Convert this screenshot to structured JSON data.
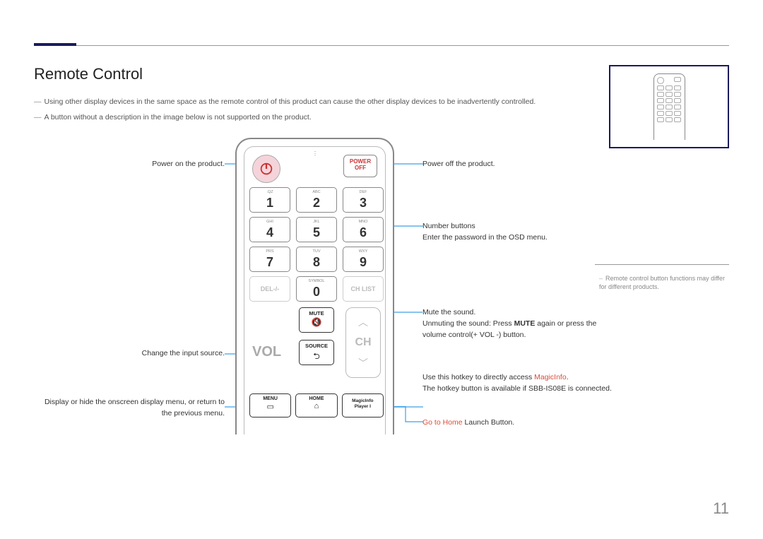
{
  "title": "Remote Control",
  "notes": {
    "n1": "Using other display devices in the same space as the remote control of this product can cause the other display devices to be inadvertently controlled.",
    "n2": "A button without a description in the image below is not supported on the product."
  },
  "buttons": {
    "power_off_line1": "POWER",
    "power_off_line2": "OFF",
    "keys": [
      {
        "sub": ".QZ",
        "d": "1"
      },
      {
        "sub": "ABC",
        "d": "2"
      },
      {
        "sub": "DEF",
        "d": "3"
      },
      {
        "sub": "GHI",
        "d": "4"
      },
      {
        "sub": "JKL",
        "d": "5"
      },
      {
        "sub": "MNO",
        "d": "6"
      },
      {
        "sub": "PRS",
        "d": "7"
      },
      {
        "sub": "TUV",
        "d": "8"
      },
      {
        "sub": "WXY",
        "d": "9"
      }
    ],
    "del": "DEL-/-",
    "symbol_sub": "SYMBOL",
    "zero": "0",
    "chlist": "CH LIST",
    "mute": "MUTE",
    "source": "SOURCE",
    "vol": "VOL",
    "ch": "CH",
    "menu": "MENU",
    "home": "HOME",
    "magicinfo_l1": "MagicInfo",
    "magicinfo_l2": "Player I"
  },
  "callouts": {
    "left": {
      "power_on": "Power on the product.",
      "source": "Change the input source.",
      "menu": "Display or hide the onscreen display menu, or return to the previous menu."
    },
    "right": {
      "power_off": "Power off the product.",
      "numbers_l1": "Number buttons",
      "numbers_l2": "Enter the password in the OSD menu.",
      "mute_l1": "Mute the sound.",
      "mute_l2a": "Unmuting the sound: Press ",
      "mute_l2b": "MUTE",
      "mute_l2c": " again or press the volume control(+ VOL -) button.",
      "magic_l1a": "Use this hotkey to directly access ",
      "magic_l1b": "MagicInfo",
      "magic_l1c": ".",
      "magic_l2": "The hotkey button is available if SBB-IS08E is connected.",
      "home_a": "Go to Home",
      "home_b": " Launch Button."
    }
  },
  "footnote": "Remote control button functions may differ for different products.",
  "page": "11"
}
